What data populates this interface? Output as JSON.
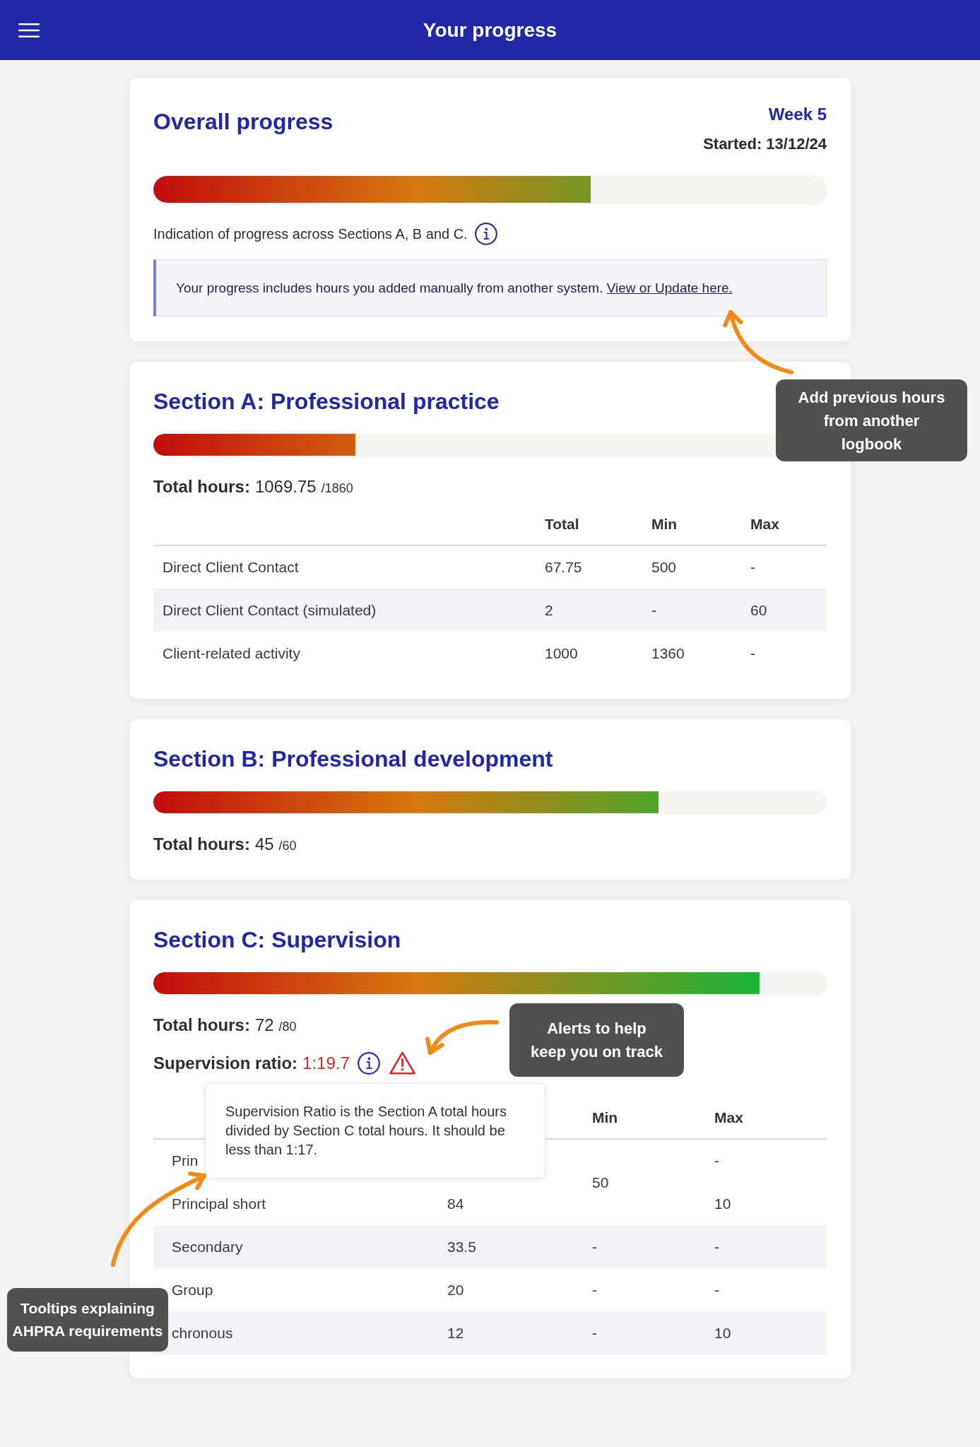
{
  "app_bar": {
    "title": "Your progress"
  },
  "overall": {
    "title": "Overall progress",
    "week": "Week 5",
    "started": "Started: 13/12/24",
    "level": 0.65,
    "caption": "Indication of progress across Sections A, B and C.",
    "notice": {
      "text": "Your progress includes hours you added manually from another system.",
      "link": "View or Update here."
    }
  },
  "sections": [
    {
      "title": "Section A: Professional practice",
      "level": 0.3,
      "total": {
        "label": "Total hours:",
        "value": "1069.75",
        "target": "/1860"
      },
      "table": {
        "headings": {
          "total": "Total",
          "min": "Min",
          "max": "Max"
        },
        "rows": [
          {
            "name": "Direct Client Contact",
            "total": "67.75",
            "min": "500",
            "max": "-",
            "shaded": false
          },
          {
            "name": "Direct Client Contact (simulated)",
            "total": "2",
            "min": "-",
            "max": "60",
            "shaded": true
          },
          {
            "name": "Client-related activity",
            "total": "1000",
            "min": "1360",
            "max": "-",
            "shaded": false
          }
        ]
      }
    },
    {
      "title": "Section B: Professional development",
      "level": 0.75,
      "total": {
        "label": "Total hours:",
        "value": "45",
        "target": "/60"
      }
    },
    {
      "title": "Section C: Supervision",
      "level": 0.9,
      "total": {
        "label": "Total hours:",
        "value": "72",
        "target": "/80"
      },
      "ratio": {
        "label": "Supervision ratio:",
        "value": "1:19.7",
        "alert": true
      },
      "tooltip": {
        "text": "Supervision Ratio is the Section A total hours divided by Section C total hours. It should be less than 1:17."
      },
      "table": {
        "headings": {
          "min": "Min",
          "max": "Max"
        },
        "rows": [
          {
            "name": "Prin",
            "min": "50",
            "max": "-",
            "shaded": false
          },
          {
            "name": "Principal short",
            "total": "84",
            "max": "10",
            "shaded": false
          },
          {
            "name": "Secondary",
            "total": "33.5",
            "min": "-",
            "max": "-",
            "shaded": true
          },
          {
            "name": "Group",
            "total": "20",
            "min": "-",
            "max": "-",
            "shaded": false
          },
          {
            "name": "chronous",
            "total": "12",
            "min": "-",
            "max": "10",
            "shaded": true
          }
        ]
      }
    }
  ],
  "annotations": [
    {
      "text": "Add previous hours from another logbook"
    },
    {
      "text": "Alerts to help keep you on track"
    },
    {
      "text": "Tooltips explaining AHPRA requirements"
    }
  ]
}
